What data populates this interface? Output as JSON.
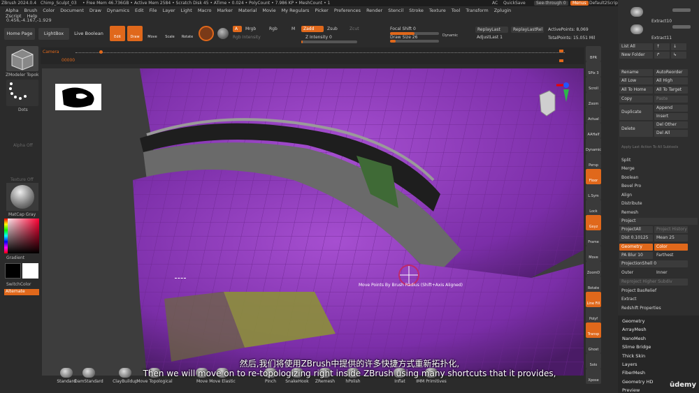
{
  "titlebar": {
    "app": "ZBrush 2024.0.4",
    "file": "Chimp_Sculpt_03",
    "stats": "• Free Mem 46.736GB • Active Mem 2584 • Scratch Disk 45 • ATime • 0.024 • PolyCount • 7.986 KP • MeshCount • 1",
    "ac": "AC",
    "quicksave": "QuickSave",
    "see_through": "See-through 0",
    "menus": "Menus",
    "script": "Default2Script"
  },
  "menus": [
    "Alpha",
    "Brush",
    "Color",
    "Document",
    "Draw",
    "Dynamics",
    "Edit",
    "File",
    "Layer",
    "Light",
    "Macro",
    "Marker",
    "Material",
    "Movie",
    "My Regulars",
    "Picker",
    "Preferences",
    "Render",
    "Stencil",
    "Stroke",
    "Texture",
    "Tool",
    "Transform",
    "Zplugin",
    "Zscript",
    "Help"
  ],
  "coords": "0.456,-4.167,-1.929",
  "toolbar": {
    "home": "Home Page",
    "lightbox": "LightBox",
    "live_boolean": "Live Boolean",
    "edit": "Edit",
    "draw": "Draw",
    "move": "Move",
    "scale": "Scale",
    "rotate": "Rotate",
    "a": "A",
    "mrgb": "Mrgb",
    "rgb": "Rgb",
    "m": "M",
    "zadd": "Zadd",
    "zsub": "Zsub",
    "zcut": "Zcut",
    "rgb_intensity": "Rgb Intensity",
    "z_intensity": "Z Intensity 0",
    "focal_shift": "Focal Shift 0",
    "draw_size": "Draw Size 26",
    "dynamic": "Dynamic",
    "replay_last": "ReplayLast",
    "replay_last_rel": "ReplayLastRel",
    "adjust_last": "AdjustLast 1",
    "active_points": "ActivePoints: 8,069",
    "total_points": "TotalPoints: 15.051 Mil"
  },
  "timeline": {
    "label": "Camera",
    "frame": "00000"
  },
  "left": {
    "zmodeler": "ZModeler Topok",
    "dots": "Dots",
    "alpha_off": "Alpha Off",
    "texture_off": "Texture Off",
    "matcap": "MatCap Gray",
    "gradient": "Gradient",
    "switchcolor": "SwitchColor",
    "alternate": "Alternate"
  },
  "viewport": {
    "tooltip": "Move Points By Brush Radius (Shift+Axis Aligned)"
  },
  "captions": {
    "zh": "然后,我们将使用ZBrush中提供的许多快捷方式重新拓扑化,",
    "en": "Then we will move on to re-topologizing right inside ZBrush using many shortcuts that it provides,"
  },
  "brushes": [
    "Standard",
    "DamStandard",
    "ClayBuildup",
    "Move Topological",
    "Move",
    "Move Elastic",
    "Pinch",
    "SnakeHook",
    "ZRemesh",
    "hPolish",
    "Inflat",
    "IMM Primitives"
  ],
  "right_shelf": [
    "BPR",
    "SPix 3",
    "Scroll",
    "Zoom",
    "Actual",
    "AAHalf",
    "Dynamic",
    "Persp",
    "Floor",
    "L.Sym",
    "Lock",
    "Gxyz",
    "Frame",
    "Move",
    "ZoomD",
    "Rotate",
    "Line Fill",
    "Polyf",
    "Transp",
    "Ghost",
    "Solo",
    "Xpose"
  ],
  "palette": {
    "subtools": [
      "Extract10",
      "Extract11"
    ],
    "list_all": "List All",
    "new_folder": "New Folder",
    "rename": "Rename",
    "autoreorder": "AutoReorder",
    "all_low": "All Low",
    "all_high": "All High",
    "all_to_home": "All To Home",
    "all_to_target": "All To Target",
    "copy": "Copy",
    "paste": "Paste",
    "duplicate": "Duplicate",
    "append": "Append",
    "insert": "Insert",
    "delete": "Delete",
    "del_other": "Del Other",
    "del_all": "Del All",
    "apply_last": "Apply Last Action To All Subtools",
    "split": "Split",
    "merge": "Merge",
    "boolean": "Boolean",
    "bevel_pro": "Bevel Pro",
    "align": "Align",
    "distribute": "Distribute",
    "remesh": "Remesh",
    "project": "Project",
    "project_all": "ProjectAll",
    "project_history": "Project History",
    "dist": "Dist 0.10125",
    "mean": "Mean 25",
    "geometry": "Geometry",
    "color": "Color",
    "pa_blur": "PA Blur 10",
    "farthest": "Farthest",
    "projection_shell": "ProjectionShell 0",
    "outer": "Outer",
    "inner": "Inner",
    "reproject": "Reproject Higher Subdiv",
    "project_basrelief": "Project BasRelief",
    "extract": "Extract",
    "redshift": "Redshift Properties",
    "sections": [
      "Geometry",
      "ArrayMesh",
      "NanoMesh",
      "Slime Bridge",
      "Thick Skin",
      "Layers",
      "FiberMesh",
      "Geometry HD",
      "Preview"
    ]
  },
  "watermark": "ūdemy",
  "colors": {
    "accent": "#e0681b",
    "mesh": "#9b3fc4"
  }
}
